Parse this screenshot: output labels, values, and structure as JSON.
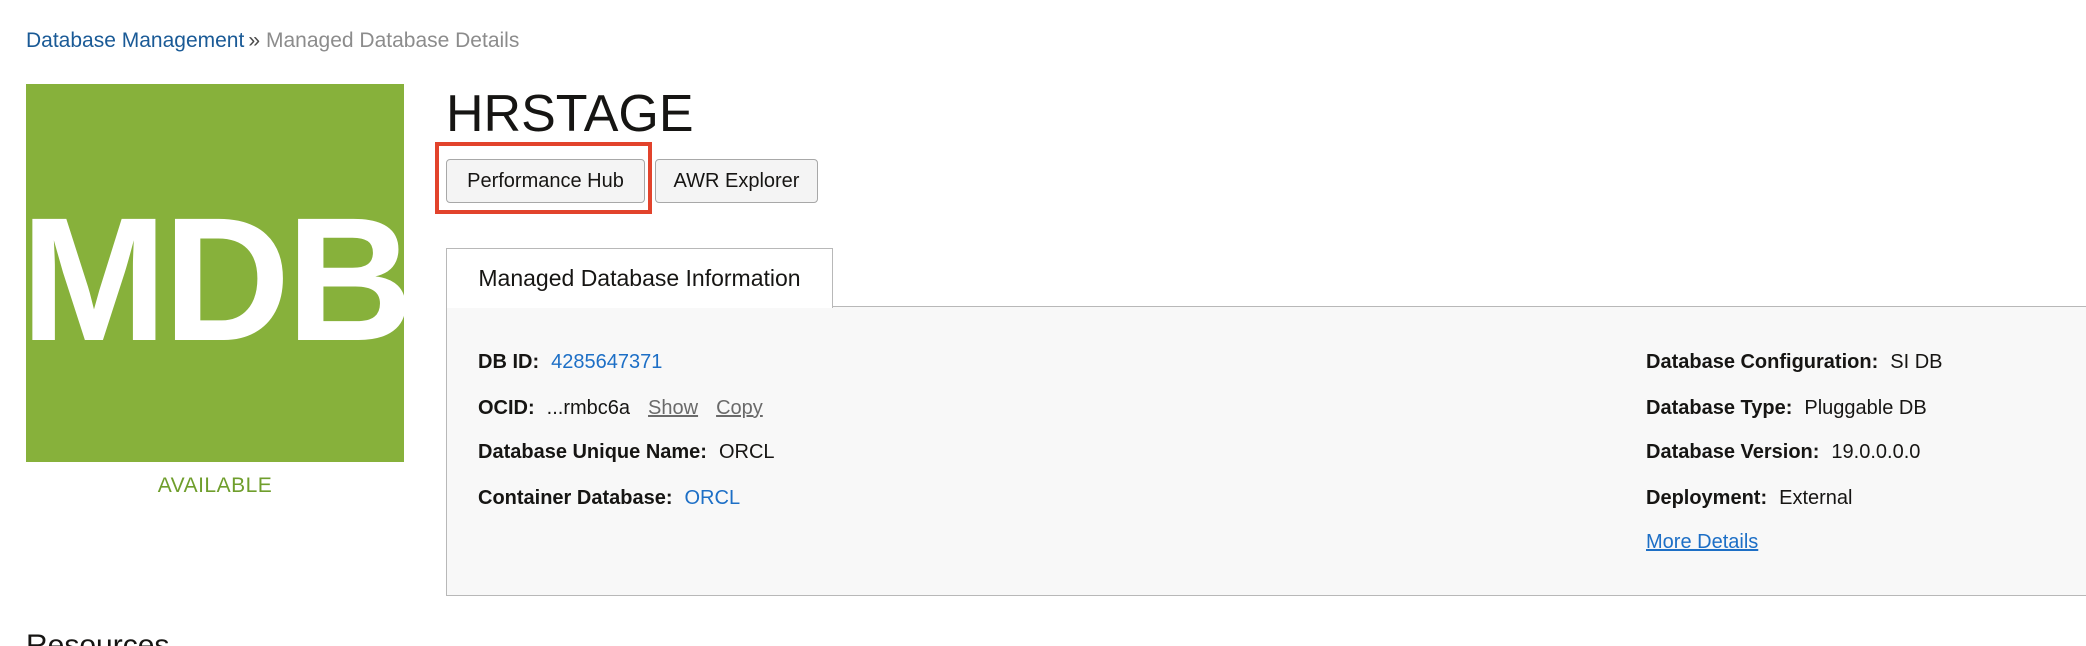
{
  "breadcrumb": {
    "parent": "Database Management",
    "separator": "»",
    "current": "Managed Database Details"
  },
  "tile": {
    "text": "MDB",
    "color": "#87b13b",
    "status": "AVAILABLE"
  },
  "title": "HRSTAGE",
  "buttons": {
    "performance_hub": "Performance Hub",
    "awr_explorer": "AWR Explorer"
  },
  "tab": {
    "label": "Managed Database Information"
  },
  "info": {
    "db_id": {
      "label": "DB ID:",
      "value": "4285647371"
    },
    "ocid": {
      "label": "OCID:",
      "value": "...rmbc6a",
      "show": "Show",
      "copy": "Copy"
    },
    "unique_name": {
      "label": "Database Unique Name:",
      "value": "ORCL"
    },
    "container_db": {
      "label": "Container Database:",
      "value": "ORCL"
    },
    "configuration": {
      "label": "Database Configuration:",
      "value": "SI DB"
    },
    "type": {
      "label": "Database Type:",
      "value": "Pluggable DB"
    },
    "version": {
      "label": "Database Version:",
      "value": "19.0.0.0.0"
    },
    "deployment": {
      "label": "Deployment:",
      "value": "External"
    },
    "more_details": "More Details"
  },
  "resources_heading": "Resources",
  "colors": {
    "link": "#1d6fc6",
    "highlight": "#e2432c",
    "status": "#6f9e2c"
  }
}
